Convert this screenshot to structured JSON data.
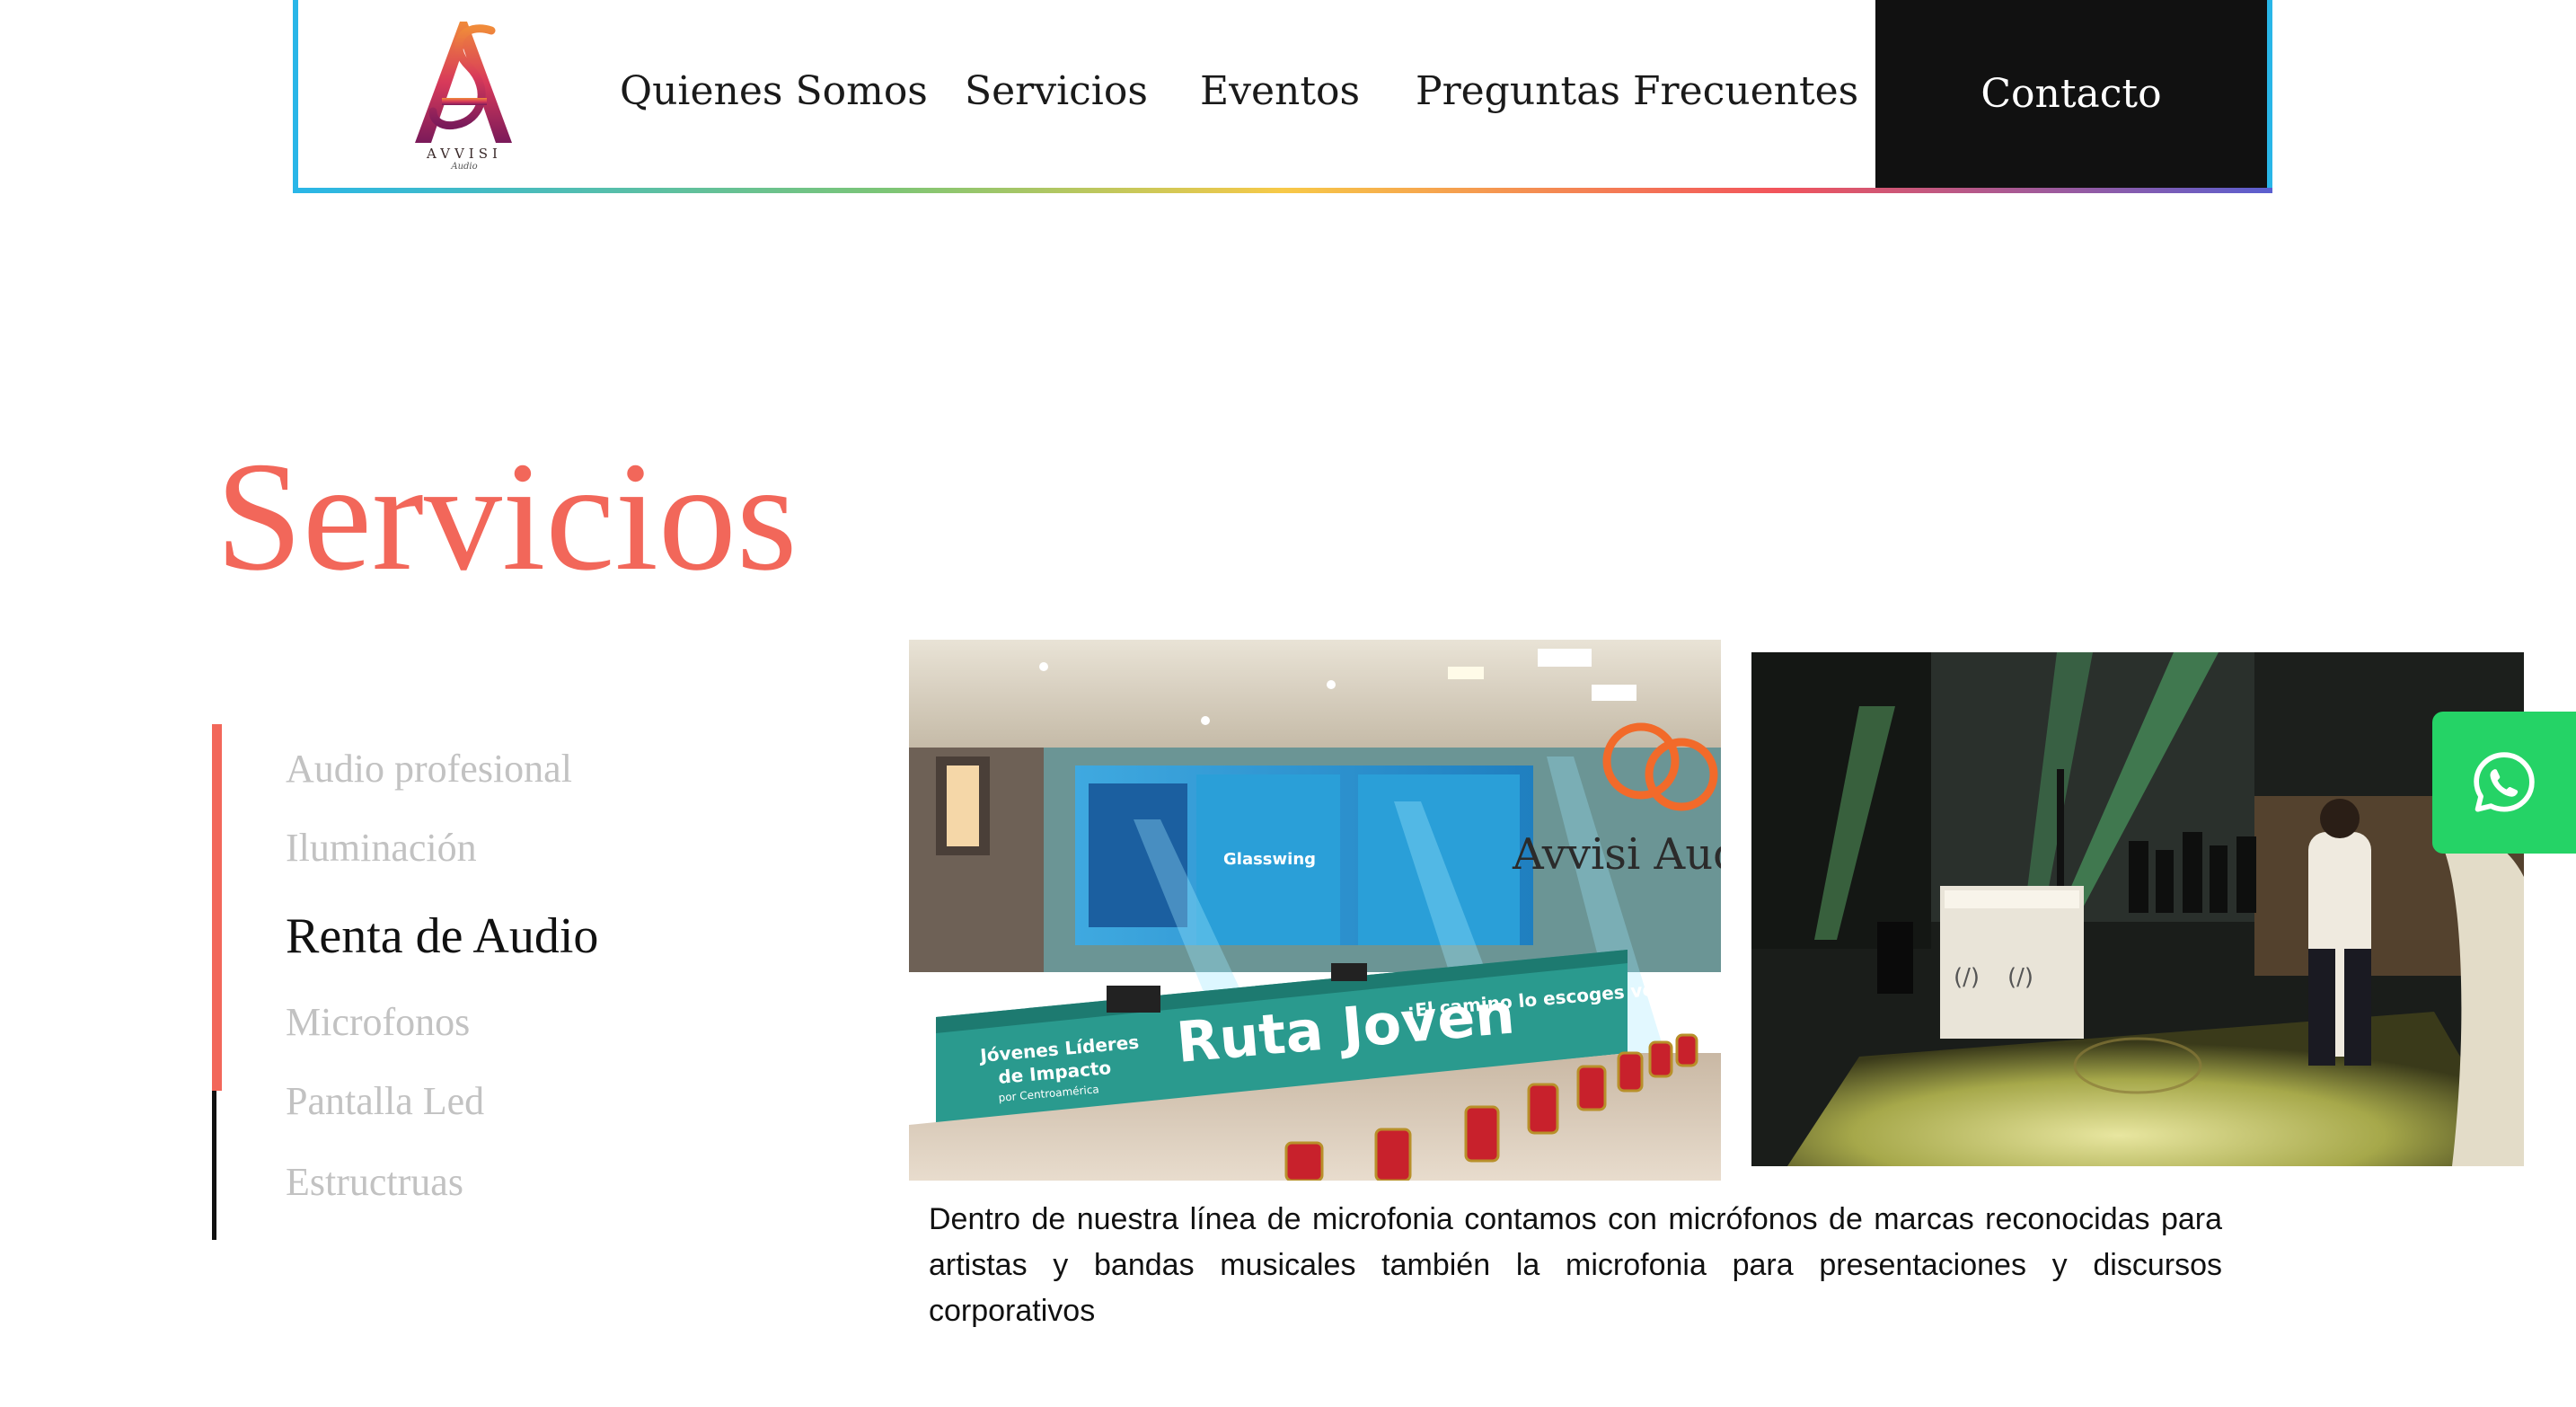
{
  "header": {
    "logo_text": "AVVISI",
    "logo_sub": "Audio",
    "nav": [
      {
        "label": "Quienes Somos"
      },
      {
        "label": "Servicios"
      },
      {
        "label": "Eventos"
      },
      {
        "label": "Preguntas Frecuentes"
      }
    ],
    "contact_label": "Contacto"
  },
  "section": {
    "title": "Servicios"
  },
  "menu": {
    "items": [
      {
        "label": "Audio profesional"
      },
      {
        "label": "Iluminación"
      },
      {
        "label": "Renta de Audio"
      },
      {
        "label": "Microfonos"
      },
      {
        "label": "Pantalla Led"
      },
      {
        "label": "Estructruas"
      }
    ],
    "active_index": 2
  },
  "photos": {
    "left": {
      "banner_main": "Ruta Joven",
      "banner_tagline": "¡El camino lo escoges vos!",
      "banner_left_line1": "Jóvenes Líderes",
      "banner_left_line2": "de Impacto",
      "banner_left_line3": "por Centroamérica",
      "screen_brand": "Glasswing",
      "watermark": "Avvisi Aud"
    }
  },
  "description": "Dentro de nuestra línea de microfonia contamos con micrófonos de marcas reconocidas para artistas y bandas musicales también la microfonia para presentaciones y discursos corporativos",
  "colors": {
    "accent": "#f2675a",
    "nav_border": "#29b6e8",
    "contact_bg": "#111111",
    "menu_inactive": "#c2c2c2",
    "whatsapp": "#25d366"
  },
  "icons": {
    "whatsapp": "whatsapp-icon"
  }
}
